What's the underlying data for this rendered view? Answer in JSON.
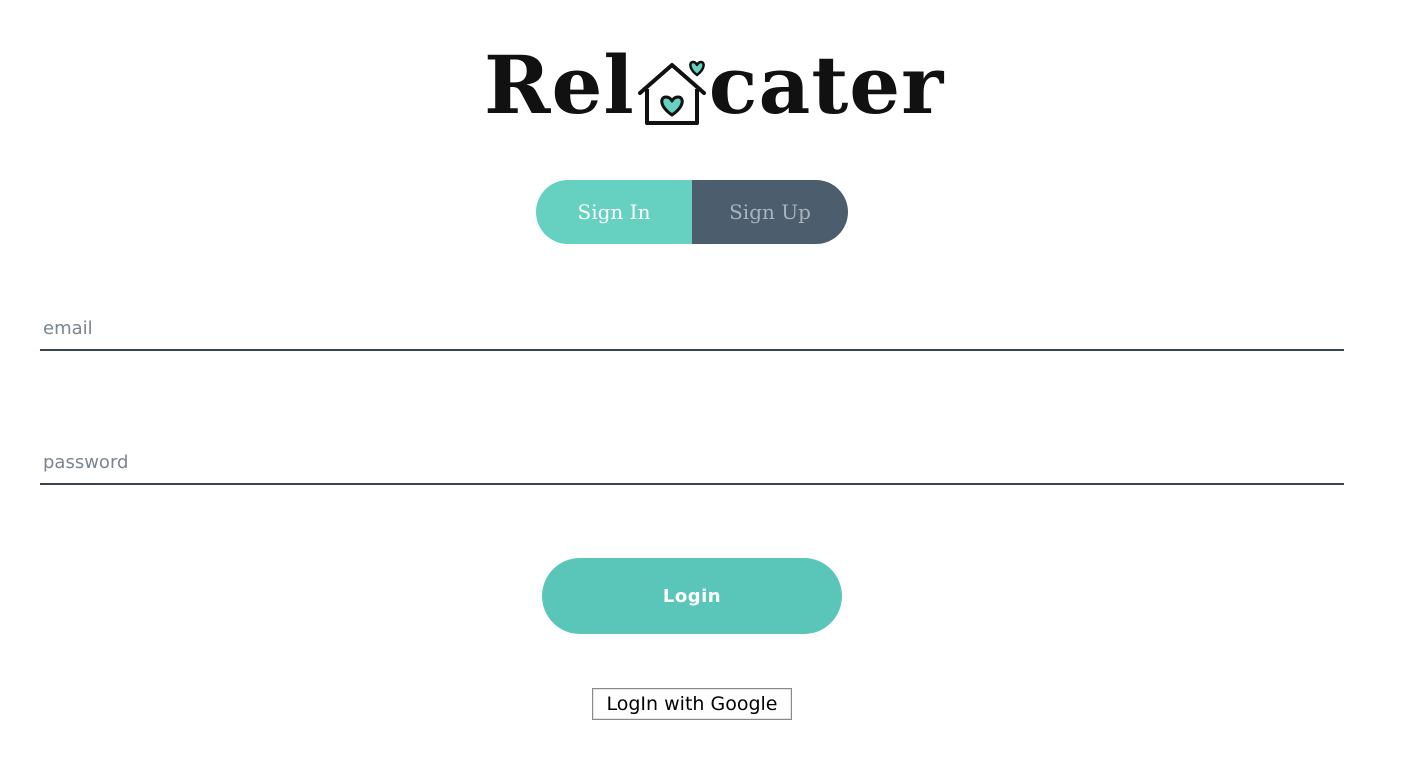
{
  "brand": {
    "name_prefix": "Rel",
    "name_suffix": "cater",
    "accent_color": "#66d1c1",
    "dark_color": "#4c5d6e"
  },
  "tabs": [
    {
      "label": "Sign In",
      "active": true
    },
    {
      "label": "Sign Up",
      "active": false
    }
  ],
  "form": {
    "email": {
      "value": "",
      "placeholder": "email"
    },
    "password": {
      "value": "",
      "placeholder": "password"
    },
    "login_label": "Login",
    "google_label": "LogIn with Google"
  },
  "icons": {
    "logo_o": "house-heart-icon"
  }
}
